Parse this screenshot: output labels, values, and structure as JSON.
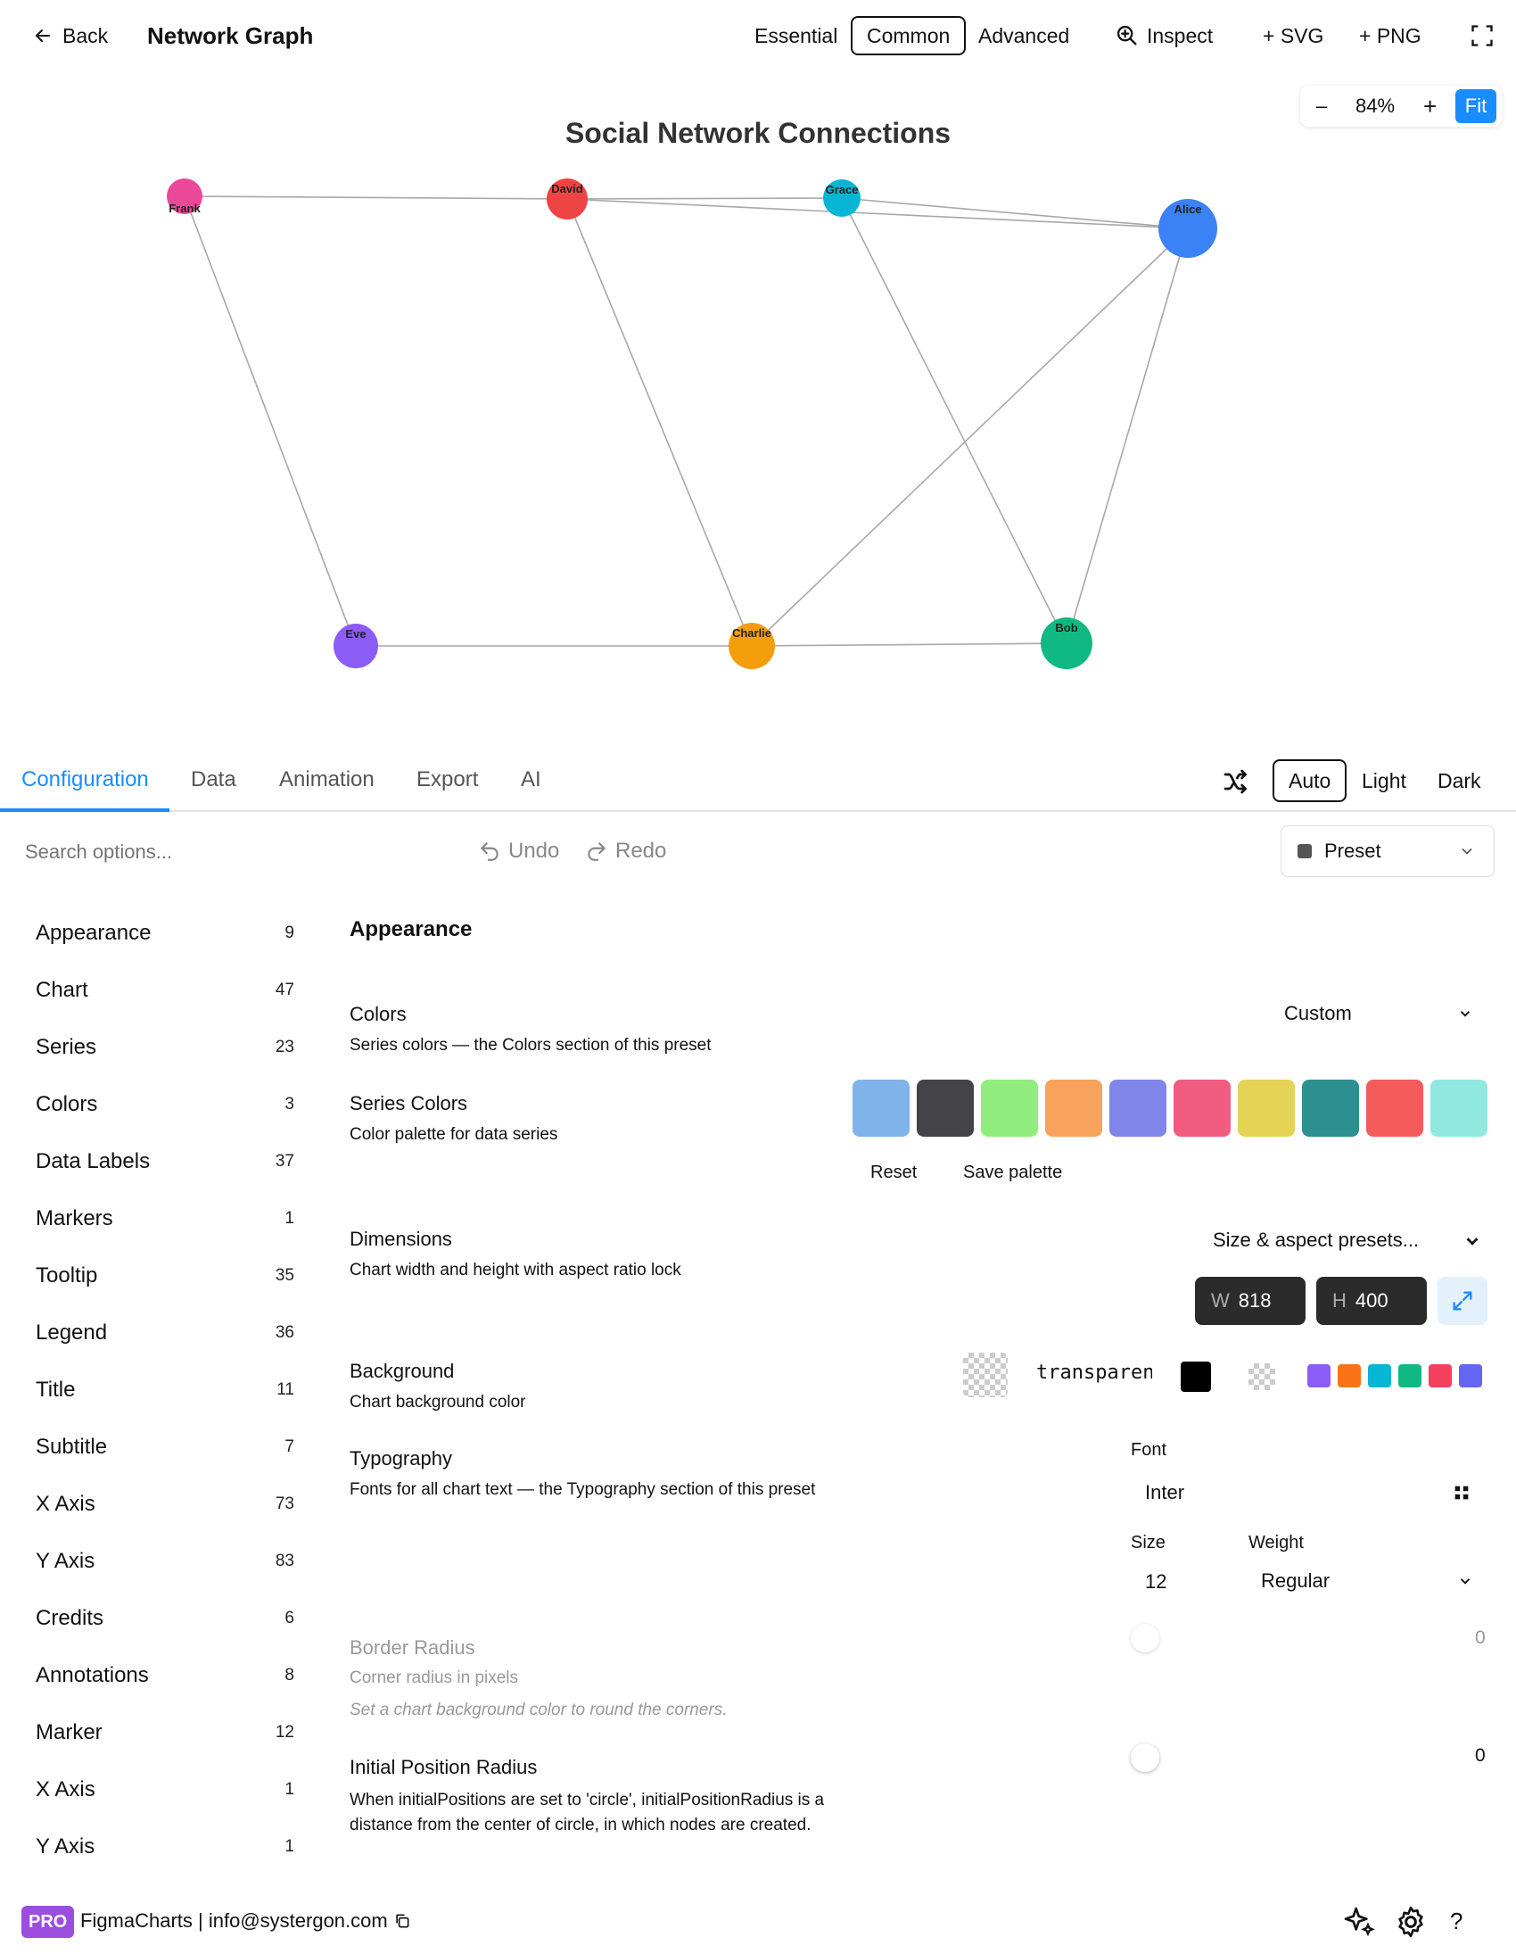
{
  "topbar": {
    "back_label": "Back",
    "title": "Network Graph",
    "modes": [
      "Essential",
      "Common",
      "Advanced"
    ],
    "active_mode": "Common",
    "inspect_label": "Inspect",
    "svg_label": "+ SVG",
    "png_label": "+ PNG"
  },
  "zoom": {
    "minus": "–",
    "value": "84%",
    "plus": "+",
    "fit": "Fit"
  },
  "chart_data": {
    "type": "network",
    "title": "Social Network Connections",
    "nodes": [
      {
        "name": "Frank",
        "color": "#ec4899"
      },
      {
        "name": "David",
        "color": "#ef4444"
      },
      {
        "name": "Grace",
        "color": "#06b6d4"
      },
      {
        "name": "Alice",
        "color": "#3b82f6"
      },
      {
        "name": "Eve",
        "color": "#8b5cf6"
      },
      {
        "name": "Charlie",
        "color": "#f59e0b"
      },
      {
        "name": "Bob",
        "color": "#10b981"
      }
    ],
    "links": [
      [
        "Frank",
        "David"
      ],
      [
        "Frank",
        "Eve"
      ],
      [
        "David",
        "Grace"
      ],
      [
        "David",
        "Alice"
      ],
      [
        "David",
        "Charlie"
      ],
      [
        "Grace",
        "Alice"
      ],
      [
        "Grace",
        "Bob"
      ],
      [
        "Alice",
        "Charlie"
      ],
      [
        "Alice",
        "Bob"
      ],
      [
        "Eve",
        "Charlie"
      ],
      [
        "Charlie",
        "Bob"
      ]
    ]
  },
  "tabs": [
    "Configuration",
    "Data",
    "Animation",
    "Export",
    "AI"
  ],
  "active_tab": "Configuration",
  "theme": {
    "options": [
      "Auto",
      "Light",
      "Dark"
    ],
    "active": "Auto"
  },
  "toolbar": {
    "search_placeholder": "Search options...",
    "undo": "Undo",
    "redo": "Redo",
    "preset": "Preset"
  },
  "categories": [
    {
      "label": "Appearance",
      "count": "9"
    },
    {
      "label": "Chart",
      "count": "47"
    },
    {
      "label": "Series",
      "count": "23"
    },
    {
      "label": "Colors",
      "count": "3"
    },
    {
      "label": "Data Labels",
      "count": "37"
    },
    {
      "label": "Markers",
      "count": "1"
    },
    {
      "label": "Tooltip",
      "count": "35"
    },
    {
      "label": "Legend",
      "count": "36"
    },
    {
      "label": "Title",
      "count": "11"
    },
    {
      "label": "Subtitle",
      "count": "7"
    },
    {
      "label": "X Axis",
      "count": "73"
    },
    {
      "label": "Y Axis",
      "count": "83"
    },
    {
      "label": "Credits",
      "count": "6"
    },
    {
      "label": "Annotations",
      "count": "8"
    },
    {
      "label": "Marker",
      "count": "12"
    },
    {
      "label": "X Axis",
      "count": "1"
    },
    {
      "label": "Y Axis",
      "count": "1"
    }
  ],
  "panel": {
    "heading": "Appearance",
    "colors": {
      "title": "Colors",
      "desc": "Series colors — the Colors section of this preset",
      "value": "Custom"
    },
    "series_colors": {
      "title": "Series Colors",
      "desc": "Color palette for data series",
      "swatches": [
        "#7fb3ea",
        "#434348",
        "#90ed7d",
        "#f7a35c",
        "#8085e9",
        "#f15c80",
        "#e4d354",
        "#2b908f",
        "#f45b5b",
        "#91e8e1"
      ],
      "reset": "Reset",
      "save": "Save palette"
    },
    "dimensions": {
      "title": "Dimensions",
      "desc": "Chart width and height with aspect ratio lock",
      "presets": "Size & aspect presets...",
      "w_label": "W",
      "w": "818",
      "h_label": "H",
      "h": "400"
    },
    "background": {
      "title": "Background",
      "desc": "Chart background color",
      "value": "transparent",
      "quick": [
        "#8b5cf6",
        "#f97316",
        "#06b6d4",
        "#10b981",
        "#f43f5e",
        "#6366f1"
      ]
    },
    "typography": {
      "title": "Typography",
      "desc": "Fonts for all chart text — the Typography section of this preset",
      "font_label": "Font",
      "font": "Inter",
      "size_label": "Size",
      "size": "12",
      "weight_label": "Weight",
      "weight": "Regular"
    },
    "border_radius": {
      "title": "Border Radius",
      "desc": "Corner radius in pixels",
      "note": "Set a chart background color to round the corners.",
      "value": "0"
    },
    "initial_radius": {
      "title": "Initial Position Radius",
      "desc": "When initialPositions are set to 'circle', initialPositionRadius is a distance from the center of circle, in which nodes are created.",
      "value": "0"
    }
  },
  "footer": {
    "badge": "PRO",
    "text": "FigmaCharts | info@systergon.com"
  }
}
